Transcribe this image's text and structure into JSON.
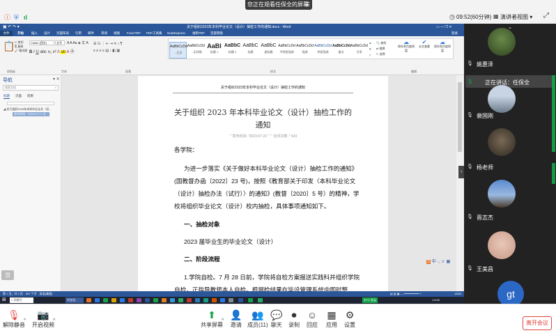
{
  "zoom_top": {
    "sharing_banner": "您正在观看任保全的屏幕",
    "time": "09:52(60分钟)",
    "view_mode": "演讲者视图"
  },
  "word": {
    "title": "关于组织2023年本科毕业论文（设计）抽检工作的通知.docx - Word",
    "tabs": [
      "文件",
      "开始",
      "插入",
      "设计",
      "页面布局",
      "引用",
      "邮件",
      "审阅",
      "视图",
      "Foxit PDF",
      "PDF工具集",
      "NoteExpress",
      "帮助"
    ],
    "tabs_cn": [
      "福昕PDF",
      "百度网盘"
    ],
    "user": "登录",
    "font_name": "Calibri (西文)",
    "font_size": "五号",
    "styles": [
      {
        "preview": "AaBbCcDd",
        "label": "→正文"
      },
      {
        "preview": "AaBbCcDd",
        "label": "→无间隔"
      },
      {
        "preview": "AaBl",
        "label": "标题 1"
      },
      {
        "preview": "AaBbC",
        "label": "标题 2"
      },
      {
        "preview": "AaBbC",
        "label": "标题"
      },
      {
        "preview": "AaBbC",
        "label": "副标题"
      },
      {
        "preview": "AaBbCcDd",
        "label": "不明显强调"
      },
      {
        "preview": "AaBbCcDd",
        "label": "强调"
      },
      {
        "preview": "AaBbCcDd",
        "label": "明显强调"
      },
      {
        "preview": "AaBbCcDd",
        "label": "要点"
      },
      {
        "preview": "AaBbCcDd",
        "label": "引用"
      }
    ],
    "right_tools": [
      "查找",
      "替换",
      "选择",
      "保存到百度网盘",
      "论文查重",
      "保存到百度网盘"
    ],
    "groups": [
      "剪贴板",
      "字体",
      "段落",
      "样式",
      "编辑"
    ],
    "nav": {
      "title": "导航",
      "search_placeholder": "搜索文档",
      "tabs": [
        "标题",
        "页面",
        "结果"
      ],
      "item1": "关于组织2023年本科毕业论文（设...",
      "item2": "发布时间：2023-07-21 访..."
    },
    "header_text": "关于组织2023年本科毕业论文（设计）抽检工作的通知",
    "doc_title_line1": "关于组织 2023 年本科毕业论文（设计）抽检工作的",
    "doc_title_line2": "通知",
    "meta": "“ ”发布时间：”2023-07-21” “ ” 访问次数：” 643",
    "salutation": "各学院：",
    "para1": [
      "为进一步落实《关于做好本科毕业论文（设计）抽检工作的通知》",
      "(国教督办函〔2022〕23 号)，按照《教育部关于印发〈本科毕业论文",
      "（设计）抽检办法（试行）〉的通知》(教督〔2020〕5 号）的精神，学",
      "校将组织毕业论文（设计）校内抽检，具体事项通知如下。"
    ],
    "h1": "一、抽检对象",
    "p2": "2023 届毕业生的毕业论文（设计）",
    "h2": "二、阶段流程",
    "p3a": "1.学院自检。7 月 28 日前，学院将自检方案报送实践科并组织学院",
    "p3b": "自检，正指导教师本人自检。根据检结果在毕设管理系统中即时整",
    "status": "第 1 页，共 3 页　597 个字　英语(美国)",
    "zoom": "130%",
    "taskbar_search": "在此处搜索",
    "taskbar_app": "学期刊",
    "taskbar_app2": "毕业设...",
    "tray_time": "1:6:02",
    "tray_temp": "31°C 多云"
  },
  "participants": [
    {
      "name": "姚惠泽",
      "label": "山"
    },
    {
      "name": "正在讲话：任保全",
      "label": ""
    },
    {
      "name": "裴国刚",
      "label": ""
    },
    {
      "name": "杨老师",
      "label": ""
    },
    {
      "name": "晋志杰",
      "label": ""
    },
    {
      "name": "王美昌",
      "label": ""
    },
    {
      "name": "gt",
      "label": "gt"
    }
  ],
  "bottom": {
    "items": [
      {
        "label": "解除静音",
        "icon": "mic-muted"
      },
      {
        "label": "开启视频",
        "icon": "camera-off"
      },
      {
        "label": "共享屏幕",
        "icon": "share-screen"
      },
      {
        "label": "邀请",
        "icon": "invite"
      },
      {
        "label": "成员(11)",
        "icon": "members"
      },
      {
        "label": "聊天",
        "icon": "chat"
      },
      {
        "label": "录制",
        "icon": "record"
      },
      {
        "label": "回应",
        "icon": "react"
      },
      {
        "label": "应用",
        "icon": "apps"
      },
      {
        "label": "设置",
        "icon": "settings"
      }
    ],
    "leave": "离开会议"
  },
  "colors": {
    "word_blue": "#2b579a",
    "green": "#16a34a",
    "leave_red": "#e0433a"
  }
}
